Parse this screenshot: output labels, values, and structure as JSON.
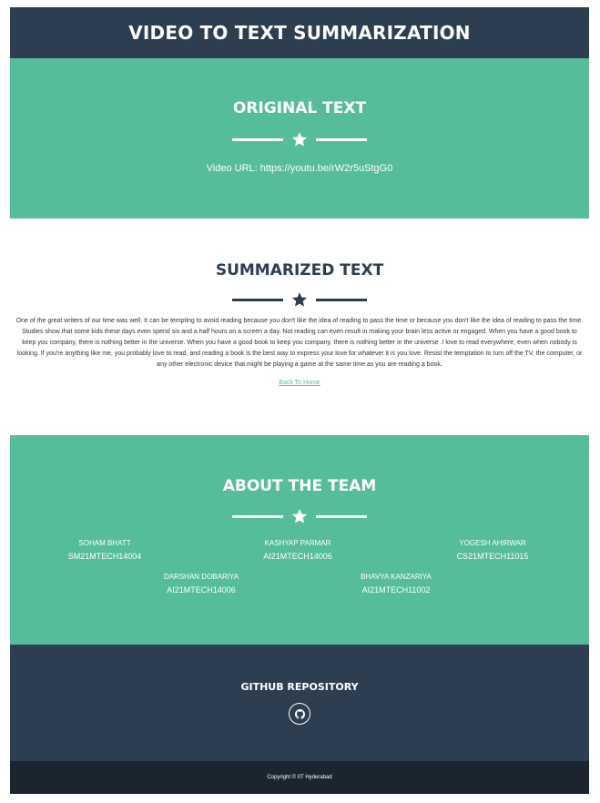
{
  "header": {
    "title": "VIDEO TO TEXT SUMMARIZATION"
  },
  "original": {
    "heading": "ORIGINAL TEXT",
    "video_url": "Video URL: https://youtu.be/rW2r5uStgG0"
  },
  "summary": {
    "heading": "SUMMARIZED TEXT",
    "text": "One of the great writers of our time was well. It can be tempting to avoid reading because you don't like the idea of reading to pass the time or because you don't like the idea of reading to pass the time. Studies show that some kids these days even spend six and a half hours on a screen a day. Not reading can even result in making your brain less active or engaged. When you have a good book to keep you company, there is nothing better in the universe. When you have a good book to keep you company, there is nothing better in the universe .I love to read everywhere, even when nobody is looking. If you're anything like me, you probably love to read, and reading a book is the best way to express your love for whatever it is you love. Resist the temptation to turn off the TV, the computer, or any other electronic device that might be playing a game at the same time as you are reading a book.",
    "back_link": "Back To Home"
  },
  "team": {
    "heading": "ABOUT THE TEAM",
    "members": [
      {
        "name": "SOHAM BHATT",
        "id": "SM21MTECH14004"
      },
      {
        "name": "KASHYAP PARMAR",
        "id": "AI21MTECH14006"
      },
      {
        "name": "YOGESH AHIRWAR",
        "id": "CS21MTECH11015"
      },
      {
        "name": "DARSHAN DOBARIYA",
        "id": "AI21MTECH14006"
      },
      {
        "name": "BHAVYA KANZARIYA",
        "id": "AI21MTECH11002"
      }
    ]
  },
  "github": {
    "heading": "GITHUB REPOSITORY",
    "icon": "github-icon"
  },
  "footer": {
    "copyright": "Copyright © IIT Hyderabad"
  },
  "colors": {
    "dark": "#2c3e50",
    "accent": "#55bd9c",
    "footer": "#1a252f"
  }
}
